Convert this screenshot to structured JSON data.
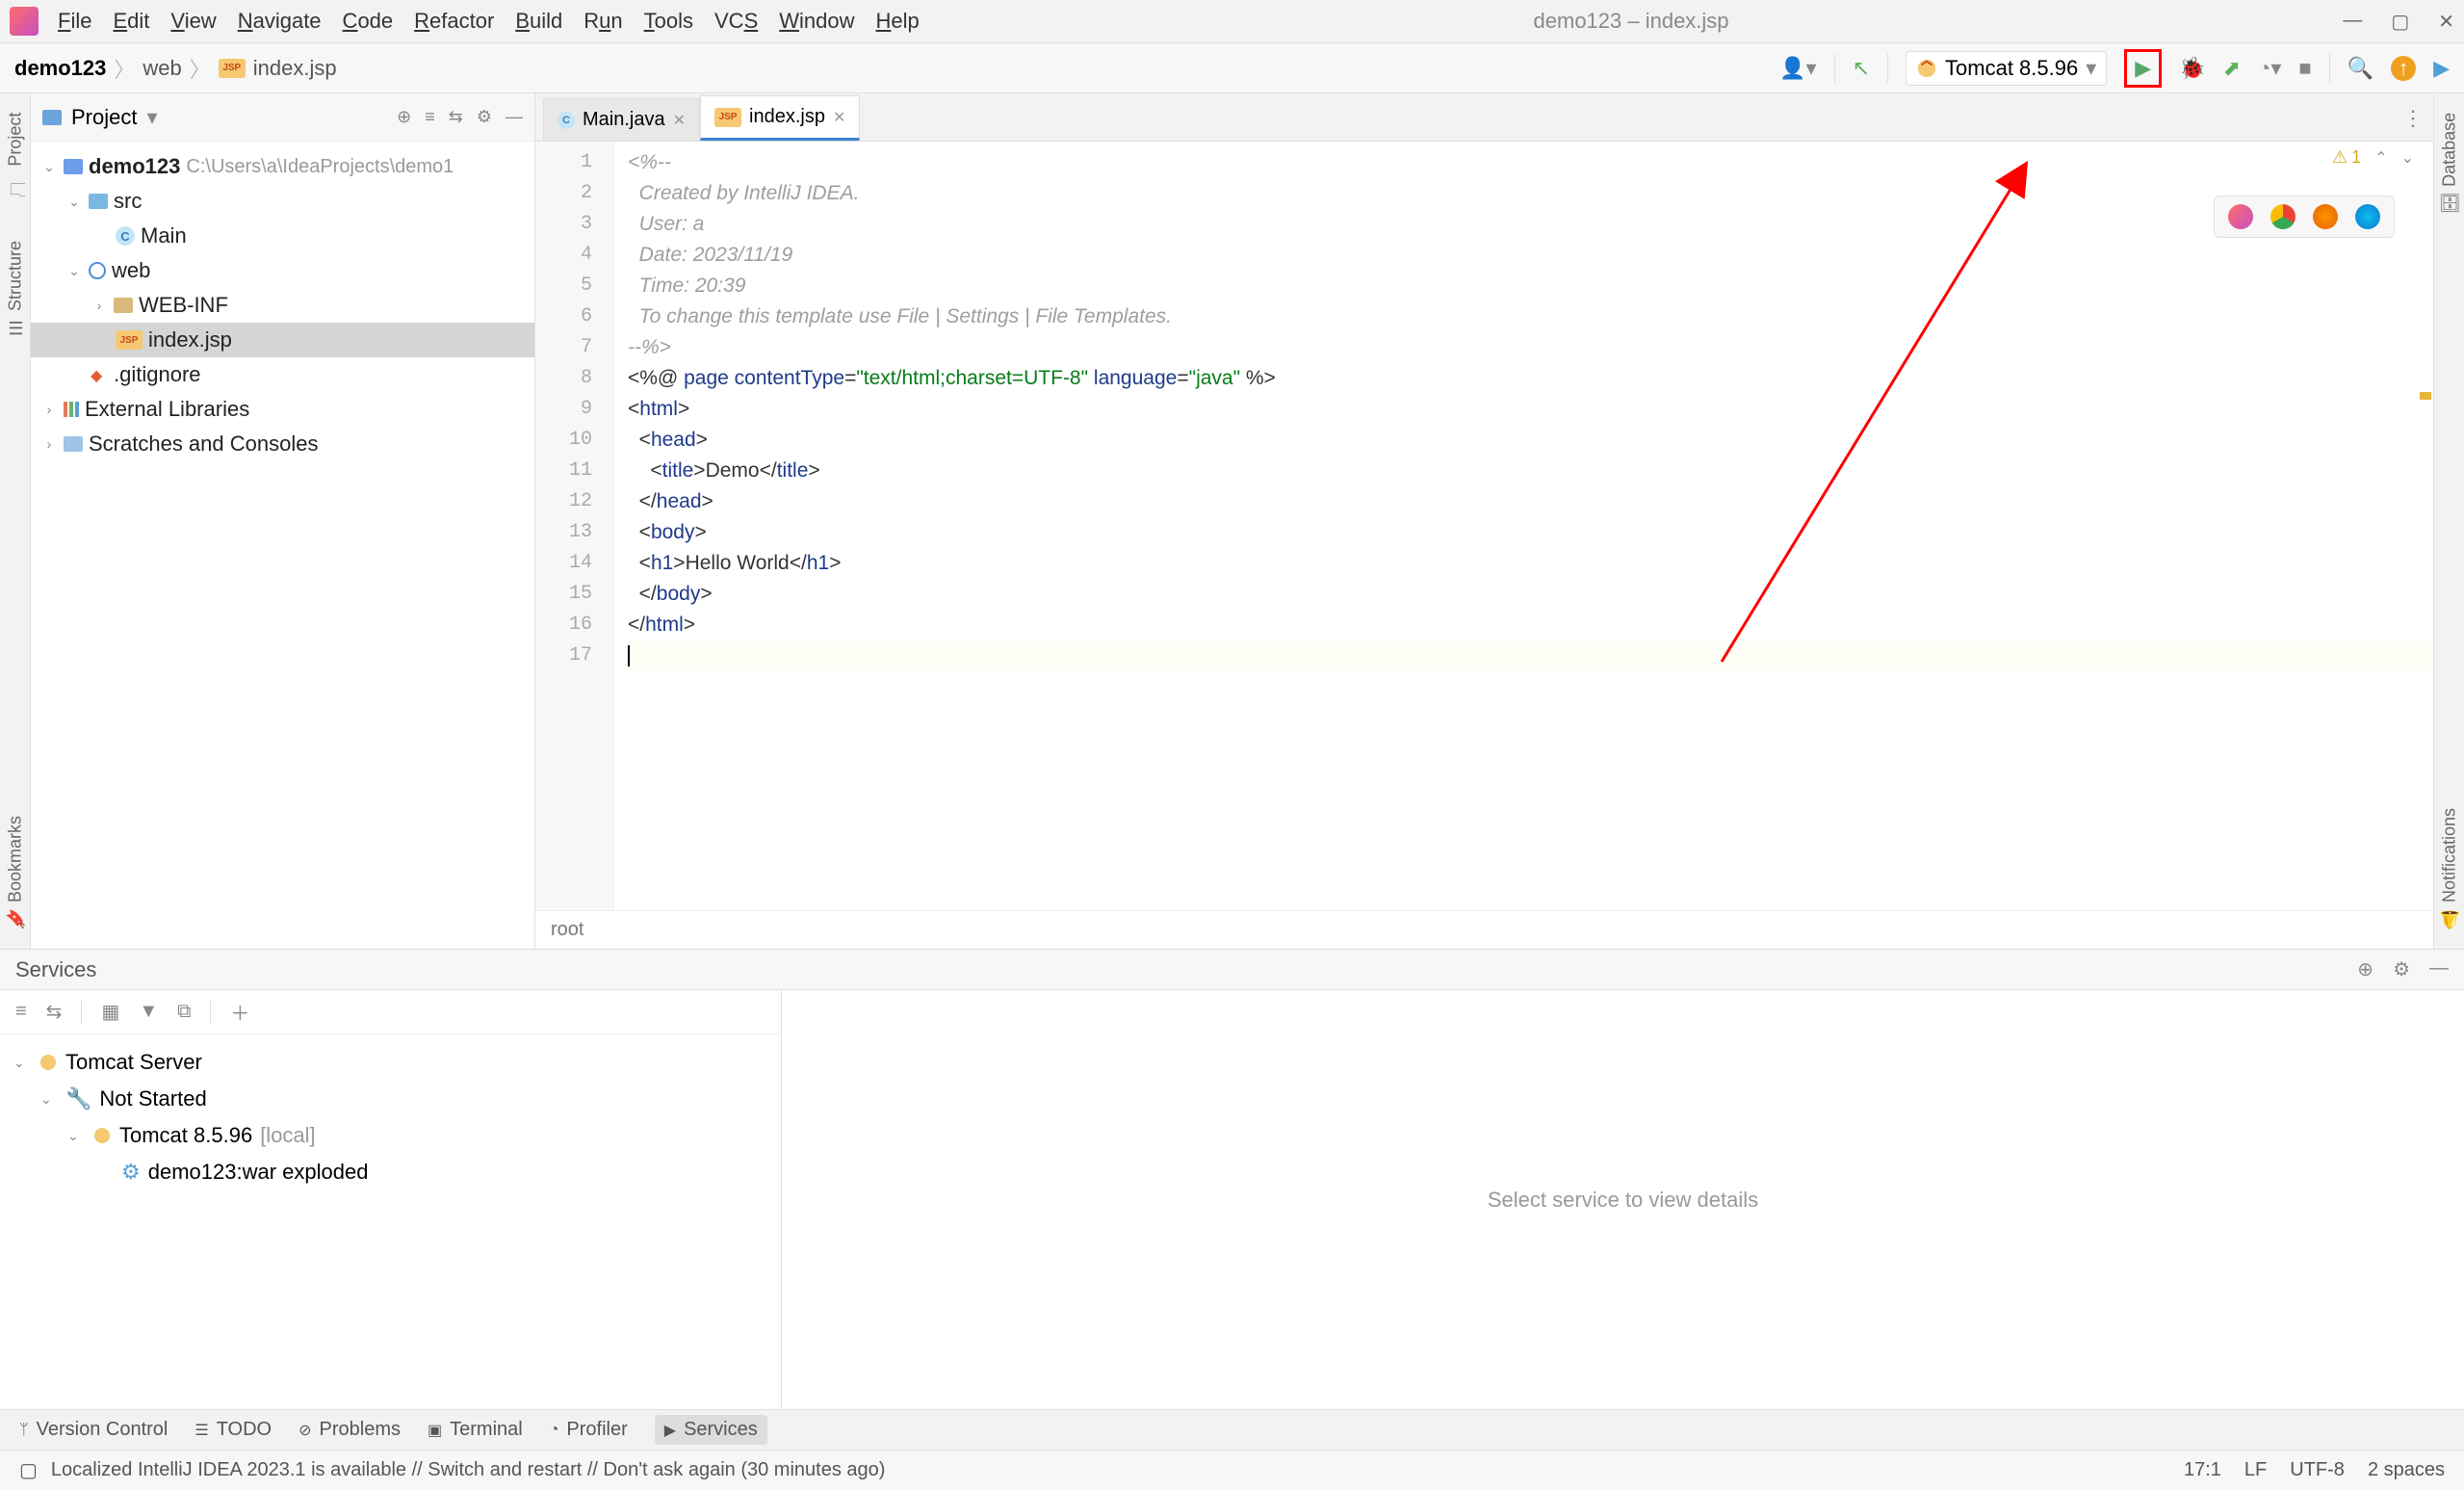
{
  "window": {
    "title": "demo123 – index.jsp",
    "menu": [
      "File",
      "Edit",
      "View",
      "Navigate",
      "Code",
      "Refactor",
      "Build",
      "Run",
      "Tools",
      "VCS",
      "Window",
      "Help"
    ]
  },
  "breadcrumb": {
    "project": "demo123",
    "folder": "web",
    "file": "index.jsp"
  },
  "run_config": {
    "name": "Tomcat 8.5.96"
  },
  "left_rail": {
    "project": "Project",
    "structure": "Structure",
    "bookmarks": "Bookmarks"
  },
  "right_rail": {
    "database": "Database",
    "notifications": "Notifications"
  },
  "project_panel": {
    "title": "Project",
    "root": {
      "name": "demo123",
      "path": "C:\\Users\\a\\IdeaProjects\\demo1"
    },
    "src": {
      "name": "src"
    },
    "main": {
      "name": "Main"
    },
    "web": {
      "name": "web"
    },
    "webinf": {
      "name": "WEB-INF"
    },
    "indexjsp": {
      "name": "index.jsp"
    },
    "gitignore": {
      "name": ".gitignore"
    },
    "extlib": {
      "name": "External Libraries"
    },
    "scratch": {
      "name": "Scratches and Consoles"
    }
  },
  "tabs": [
    {
      "label": "Main.java"
    },
    {
      "label": "index.jsp"
    }
  ],
  "code": {
    "l1": "<%--",
    "l2": "  Created by IntelliJ IDEA.",
    "l3": "  User: a",
    "l4": "  Date: 2023/11/19",
    "l5": "  Time: 20:39",
    "l6": "  To change this template use File | Settings | File Templates.",
    "l7": "--%>",
    "l8a": "<%@ ",
    "l8b": "page ",
    "l8c": "contentType",
    "l8d": "=",
    "l8e": "\"text/html;charset=UTF-8\"",
    "l8f": " language",
    "l8g": "=",
    "l8h": "\"java\"",
    "l8i": " %>",
    "l9a": "<",
    "l9b": "html",
    "l9c": ">",
    "l10a": "  <",
    "l10b": "head",
    "l10c": ">",
    "l11a": "    <",
    "l11b": "title",
    "l11c": ">",
    "l11d": "Demo",
    "l11e": "</",
    "l11f": "title",
    "l11g": ">",
    "l12a": "  </",
    "l12b": "head",
    "l12c": ">",
    "l13a": "  <",
    "l13b": "body",
    "l13c": ">",
    "l14a": "  <",
    "l14b": "h1",
    "l14c": ">",
    "l14d": "Hello World",
    "l14e": "</",
    "l14f": "h1",
    "l14g": ">",
    "l15a": "  </",
    "l15b": "body",
    "l15c": ">",
    "l16a": "</",
    "l16b": "html",
    "l16c": ">"
  },
  "editor_warnings": {
    "count": "1"
  },
  "editor_breadcrumb": "root",
  "services": {
    "title": "Services",
    "tomcat_server": "Tomcat Server",
    "not_started": "Not Started",
    "tomcat_config": "Tomcat 8.5.96",
    "tomcat_suffix": "[local]",
    "artifact": "demo123:war exploded",
    "placeholder": "Select service to view details"
  },
  "bottom_tools": {
    "version_control": "Version Control",
    "todo": "TODO",
    "problems": "Problems",
    "terminal": "Terminal",
    "profiler": "Profiler",
    "services": "Services"
  },
  "status": {
    "message": "Localized IntelliJ IDEA 2023.1 is available // Switch and restart // Don't ask again (30 minutes ago)",
    "caret": "17:1",
    "lf": "LF",
    "encoding": "UTF-8",
    "indent": "2 spaces"
  }
}
